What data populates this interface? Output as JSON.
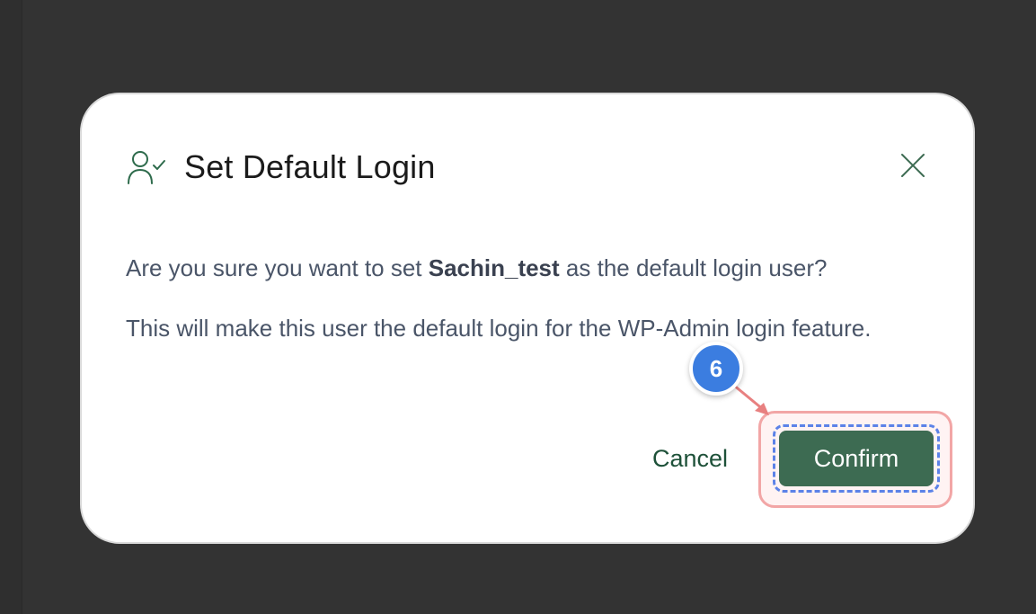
{
  "background": {
    "color": "#333333"
  },
  "modal": {
    "title": "Set Default Login",
    "icon": "user-check-icon",
    "close_icon": "close-icon",
    "message": {
      "prefix": "Are you sure you want to set ",
      "username": "Sachin_test",
      "suffix": " as the default login user?"
    },
    "description": "This will make this user the default login for the WP-Admin login feature.",
    "cancel_label": "Cancel",
    "confirm_label": "Confirm"
  },
  "annotation": {
    "step_number": "6",
    "badge_color": "#3b7de0",
    "highlight_color": "#f2a6a6",
    "focus_color": "#5b82e8"
  },
  "colors": {
    "primary": "#3d6b52",
    "link": "#1e5139",
    "title": "#1b1b1b",
    "body_text": "#4a5568"
  }
}
